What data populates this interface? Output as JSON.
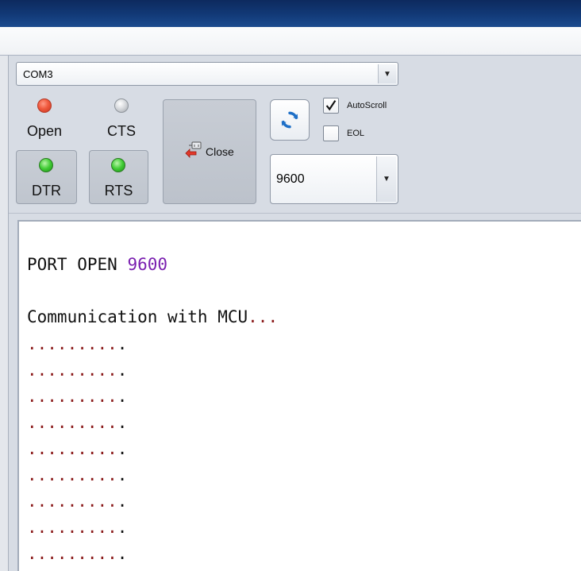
{
  "port": {
    "selected": "COM3"
  },
  "indicators": {
    "open": {
      "label": "Open",
      "color": "#f05a3e"
    },
    "cts": {
      "label": "CTS",
      "color": "#cfd2d6"
    },
    "dtr": {
      "label": "DTR",
      "color": "#3fcb33"
    },
    "rts": {
      "label": "RTS",
      "color": "#3fcb33"
    }
  },
  "close_button": {
    "label": "Close",
    "icon": "disconnect-plug-icon"
  },
  "refresh_button": {
    "icon": "refresh-icon"
  },
  "options": {
    "autoscroll": {
      "label": "AutoScroll",
      "checked": true
    },
    "eol": {
      "label": "EOL",
      "checked": false
    }
  },
  "baud": {
    "selected": "9600"
  },
  "terminal": {
    "port_open_text": "PORT OPEN",
    "port_open_baud": "9600",
    "comm_text": "Communication with MCU",
    "comm_ellipsis": "...",
    "dot_lines": [
      {
        "dots": ".........",
        "end": "."
      },
      {
        "dots": ".........",
        "end": "."
      },
      {
        "dots": ".........",
        "end": "."
      },
      {
        "dots": ".........",
        "end": "."
      },
      {
        "dots": ".........",
        "end": "."
      },
      {
        "dots": ".........",
        "end": "."
      },
      {
        "dots": ".........",
        "end": "."
      },
      {
        "dots": ".........",
        "end": "."
      },
      {
        "dots": ".........",
        "end": "."
      }
    ]
  }
}
